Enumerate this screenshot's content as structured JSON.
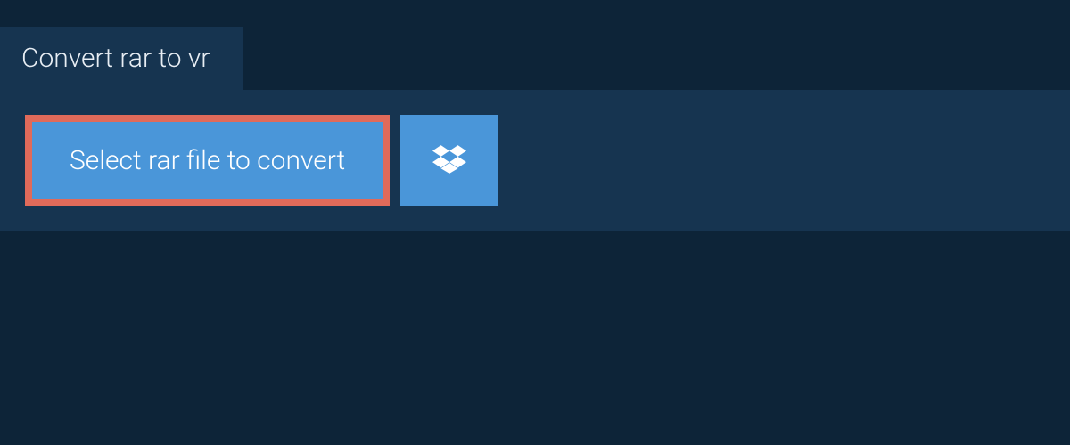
{
  "header": {
    "title": "Convert rar to vr"
  },
  "main": {
    "select_button_label": "Select rar file to convert"
  }
}
